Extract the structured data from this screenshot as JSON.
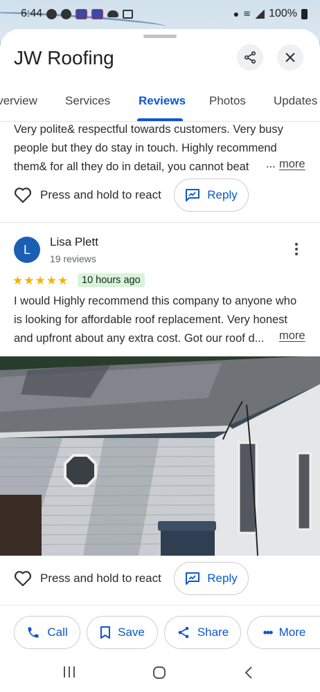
{
  "status_bar": {
    "time": "6:44",
    "battery": "100%"
  },
  "header": {
    "title": "JW Roofing"
  },
  "tabs": [
    {
      "label": "Overview"
    },
    {
      "label": "Services"
    },
    {
      "label": "Reviews"
    },
    {
      "label": "Photos"
    },
    {
      "label": "Updates"
    }
  ],
  "active_tab": "Reviews",
  "review_1": {
    "lines": [
      "Very polite& respectful towards customers. Very busy",
      "people but they do stay in touch. Highly recommend",
      "them& for all they do in detail, you cannot beat"
    ],
    "ellipsis": "...",
    "more_label": "more",
    "react_label": "Press and hold to react",
    "reply_label": "Reply"
  },
  "review_2": {
    "avatar_letter": "L",
    "name": "Lisa Plett",
    "review_count": "19 reviews",
    "rating": 5,
    "time_ago": "10 hours ago",
    "lines": [
      "I would Highly recommend this company to anyone who",
      "is looking for affordable roof replacement. Very honest",
      "and upfront about any extra cost. Got our roof d..."
    ],
    "more_label": "more",
    "react_label": "Press and hold to react",
    "reply_label": "Reply"
  },
  "actions": [
    {
      "label": "Call",
      "icon": "phone-icon"
    },
    {
      "label": "Save",
      "icon": "bookmark-icon"
    },
    {
      "label": "Share",
      "icon": "share-icon"
    },
    {
      "label": "More",
      "icon": "more-horiz-icon"
    }
  ],
  "colors": {
    "accent": "#0b57d0",
    "star": "#f4b400",
    "badge": "#d7f5d9",
    "avatar": "#1a5fb4"
  }
}
